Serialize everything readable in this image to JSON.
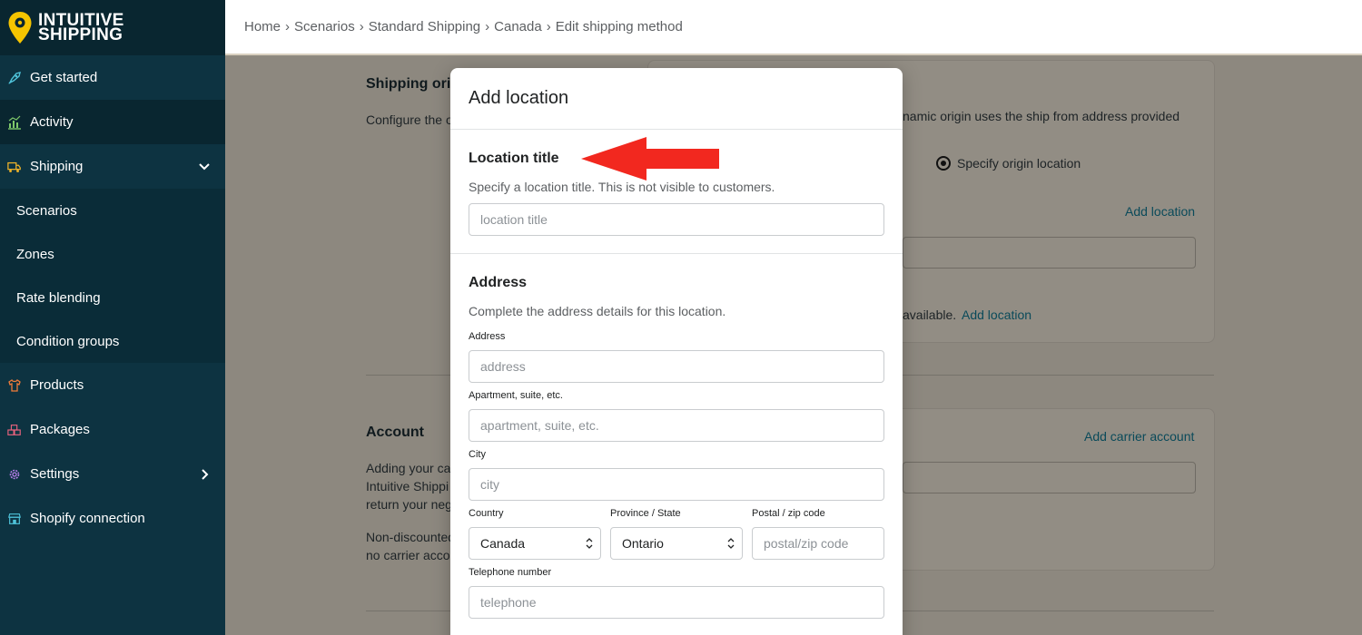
{
  "brand": {
    "line1": "INTUITIVE",
    "line2": "SHIPPING",
    "pin_color": "#f5c400"
  },
  "sidebar": {
    "items": [
      {
        "label": "Get started",
        "icon": "rocket-icon"
      },
      {
        "label": "Activity",
        "icon": "chart-icon"
      },
      {
        "label": "Shipping",
        "icon": "truck-icon"
      },
      {
        "label": "Products",
        "icon": "shirt-icon"
      },
      {
        "label": "Packages",
        "icon": "boxes-icon"
      },
      {
        "label": "Settings",
        "icon": "gear-icon"
      },
      {
        "label": "Shopify connection",
        "icon": "store-icon"
      }
    ],
    "shipping_sub": [
      {
        "label": "Scenarios"
      },
      {
        "label": "Zones"
      },
      {
        "label": "Rate blending"
      },
      {
        "label": "Condition groups"
      }
    ]
  },
  "breadcrumb": [
    "Home",
    "Scenarios",
    "Standard Shipping",
    "Canada",
    "Edit shipping method"
  ],
  "background": {
    "origin_heading": "Shipping ori",
    "origin_desc": "Configure the o",
    "dynamic_text": "namic origin uses the ship from address provided",
    "radio_label": "Specify origin location",
    "add_location": "Add location",
    "available_text": "available.",
    "add_location_2": "Add location",
    "account_heading": "Account",
    "add_carrier": "Add carrier account",
    "account_desc_1": "Adding your ca",
    "account_desc_2": "Intuitive Shippi",
    "account_desc_3": "return your neg",
    "account_desc_4": "Non-discounted",
    "account_desc_5": "no carrier acco"
  },
  "modal": {
    "title": "Add location",
    "location": {
      "title": "Location title",
      "help": "Specify a location title. This is not visible to customers.",
      "placeholder": "location title"
    },
    "address": {
      "title": "Address",
      "help": "Complete the address details for this location.",
      "address_label": "Address",
      "address_placeholder": "address",
      "apt_label": "Apartment, suite, etc.",
      "apt_placeholder": "apartment, suite, etc.",
      "city_label": "City",
      "city_placeholder": "city",
      "country_label": "Country",
      "country_value": "Canada",
      "province_label": "Province / State",
      "province_value": "Ontario",
      "postal_label": "Postal / zip code",
      "postal_placeholder": "postal/zip code",
      "phone_label": "Telephone number",
      "phone_placeholder": "telephone"
    }
  },
  "annotation": {
    "arrow_color": "#f2281f"
  }
}
